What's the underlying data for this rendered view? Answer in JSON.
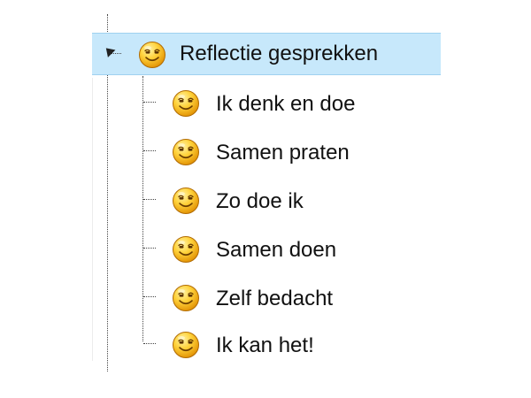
{
  "tree": {
    "root": {
      "label": "Reflectie gesprekken",
      "icon": "smiley-face-icon",
      "expanded": true,
      "selected": true
    },
    "children": [
      {
        "label": "Ik denk en doe",
        "icon": "smiley-face-icon"
      },
      {
        "label": "Samen praten",
        "icon": "smiley-face-icon"
      },
      {
        "label": "Zo doe ik",
        "icon": "smiley-face-icon"
      },
      {
        "label": "Samen doen",
        "icon": "smiley-face-icon"
      },
      {
        "label": "Zelf bedacht",
        "icon": "smiley-face-icon"
      },
      {
        "label": "Ik kan het!",
        "icon": "smiley-face-icon"
      }
    ]
  },
  "colors": {
    "selection_background": "#c7e8fb",
    "selection_border": "#9fd1ef",
    "icon_face": "#f6b51d",
    "text": "#111111"
  }
}
